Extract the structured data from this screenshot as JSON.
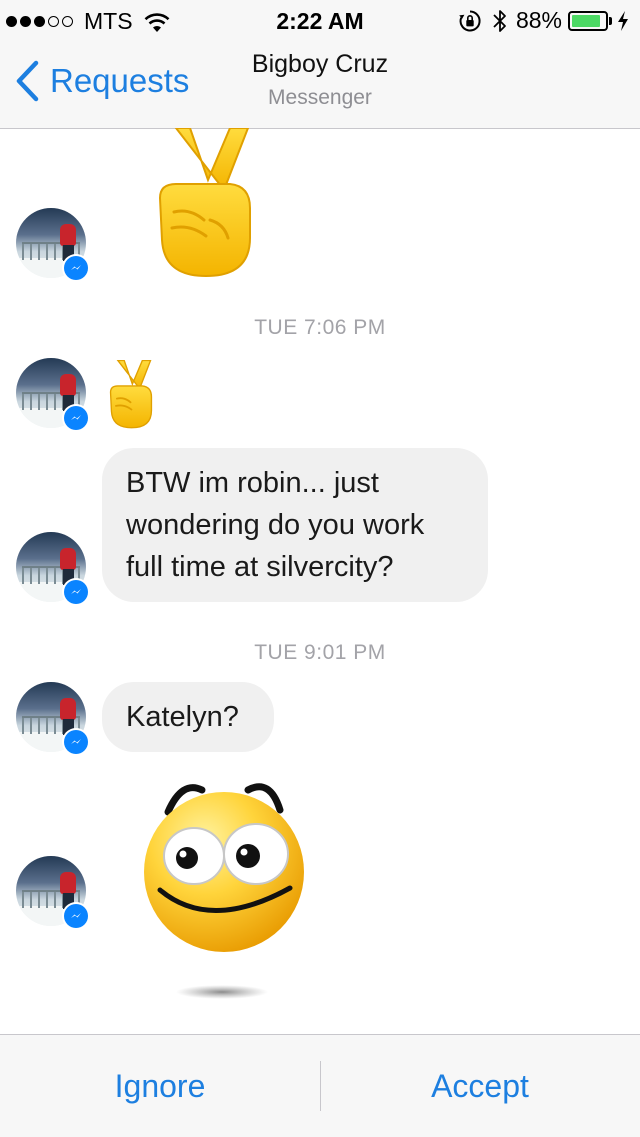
{
  "status_bar": {
    "carrier": "MTS",
    "time": "2:22 AM",
    "battery_percent": "88%",
    "battery_level": 0.88,
    "signal_bars_filled": 3,
    "signal_bars_total": 5,
    "icons": [
      "wifi-icon",
      "orientation-lock-icon",
      "bluetooth-icon",
      "battery-icon",
      "charging-icon"
    ]
  },
  "nav": {
    "back_label": "Requests",
    "title": "Bigboy Cruz",
    "subtitle": "Messenger"
  },
  "messages": [
    {
      "kind": "emoji",
      "sender": "other",
      "emoji": "victory-hand-large"
    },
    {
      "kind": "timestamp",
      "text": "TUE 7:06 PM"
    },
    {
      "kind": "emoji",
      "sender": "other",
      "emoji": "victory-hand-small"
    },
    {
      "kind": "text",
      "sender": "other",
      "lines": [
        "BTW im robin... just",
        "wondering do you work",
        "full time at silvercity?"
      ]
    },
    {
      "kind": "timestamp",
      "text": "TUE 9:01 PM"
    },
    {
      "kind": "text",
      "sender": "other",
      "lines": [
        "Katelyn?"
      ]
    },
    {
      "kind": "sticker",
      "sender": "other",
      "sticker": "smiling-face-sticker"
    }
  ],
  "actions": {
    "ignore_label": "Ignore",
    "accept_label": "Accept"
  },
  "colors": {
    "accent": "#1d7fe0",
    "bubble": "#f0f0f0",
    "timestamp": "#a3a3a8",
    "bar_background": "#f7f7f7",
    "messenger_badge": "#0a84ff",
    "battery_fill": "#4cd964"
  }
}
